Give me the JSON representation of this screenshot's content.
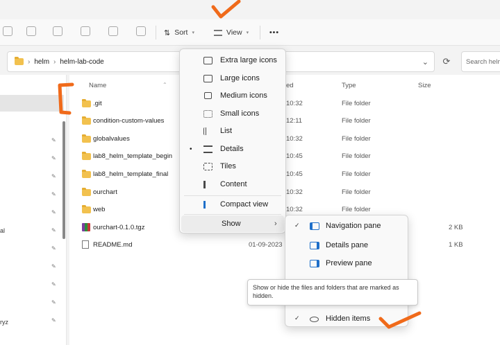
{
  "toolbar": {
    "sort_label": "Sort",
    "view_label": "View",
    "more_label": "•••"
  },
  "address": {
    "crumbs": [
      "helm",
      "helm-lab-code"
    ],
    "search_placeholder": "Search helm"
  },
  "columns": {
    "name": "Name",
    "date": "ed",
    "type": "Type",
    "size": "Size"
  },
  "files": [
    {
      "name": ".git",
      "date": "10:32",
      "type": "File folder",
      "size": "",
      "icon": "folder-icon"
    },
    {
      "name": "condition-custom-values",
      "date": "12:11",
      "type": "File folder",
      "size": "",
      "icon": "folder-icon"
    },
    {
      "name": "globalvalues",
      "date": "10:32",
      "type": "File folder",
      "size": "",
      "icon": "folder-icon"
    },
    {
      "name": "lab8_helm_template_begin",
      "date": "10:45",
      "type": "File folder",
      "size": "",
      "icon": "folder-icon"
    },
    {
      "name": "lab8_helm_template_final",
      "date": "10:45",
      "type": "File folder",
      "size": "",
      "icon": "folder-icon"
    },
    {
      "name": "ourchart",
      "date": "10:32",
      "type": "File folder",
      "size": "",
      "icon": "folder-icon"
    },
    {
      "name": "web",
      "date": "10:32",
      "type": "File folder",
      "size": "",
      "icon": "folder-icon"
    },
    {
      "name": "ourchart-0.1.0.tgz",
      "date": "",
      "type": "",
      "size": "2 KB",
      "icon": "archive-icon"
    },
    {
      "name": "README.md",
      "date": "01-09-2023",
      "type": "",
      "size": "1 KB",
      "icon": "document-icon"
    }
  ],
  "nav": {
    "partial_labels": [
      "al",
      "ryz"
    ]
  },
  "view_menu": {
    "items": [
      {
        "label": "Extra large icons",
        "icon": "extra-large-icons-icon"
      },
      {
        "label": "Large icons",
        "icon": "large-icons-icon"
      },
      {
        "label": "Medium icons",
        "icon": "medium-icons-icon"
      },
      {
        "label": "Small icons",
        "icon": "small-icons-icon"
      },
      {
        "label": "List",
        "icon": "list-icon"
      },
      {
        "label": "Details",
        "icon": "details-icon",
        "selected": true
      },
      {
        "label": "Tiles",
        "icon": "tiles-icon"
      },
      {
        "label": "Content",
        "icon": "content-icon"
      },
      {
        "label": "Compact view",
        "icon": "compact-view-icon"
      },
      {
        "label": "Show",
        "icon": "",
        "submenu": true
      }
    ]
  },
  "show_submenu": {
    "items": [
      {
        "label": "Navigation pane",
        "checked": true,
        "icon": "navigation-pane-icon"
      },
      {
        "label": "Details pane",
        "checked": false,
        "icon": "details-pane-icon"
      },
      {
        "label": "Preview pane",
        "checked": false,
        "icon": "preview-pane-icon"
      },
      {
        "label": "Hidden items",
        "checked": true,
        "icon": "eye-icon"
      }
    ]
  },
  "tooltip": {
    "text": "Show or hide the files and folders that are marked as hidden."
  },
  "colors": {
    "annotation": "#f06a1a",
    "folder": "#f2c14e",
    "accent": "#1e6fc9"
  }
}
